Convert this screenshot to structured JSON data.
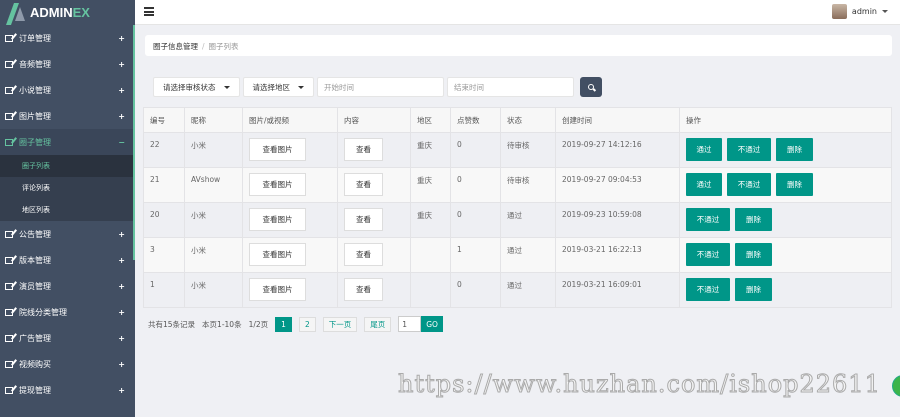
{
  "logo": {
    "main": "ADMIN",
    "accent": "EX"
  },
  "sidebar": {
    "items": [
      {
        "label": "订单管理",
        "toggle": "+"
      },
      {
        "label": "音频管理",
        "toggle": "+"
      },
      {
        "label": "小说管理",
        "toggle": "+"
      },
      {
        "label": "图片管理",
        "toggle": "+"
      },
      {
        "label": "圈子管理",
        "toggle": "−",
        "active": true,
        "children": [
          {
            "label": "圈子列表",
            "active": true
          },
          {
            "label": "评论列表"
          },
          {
            "label": "地区列表"
          }
        ]
      },
      {
        "label": "公告管理",
        "toggle": "+"
      },
      {
        "label": "版本管理",
        "toggle": "+"
      },
      {
        "label": "演员管理",
        "toggle": "+"
      },
      {
        "label": "院线分类管理",
        "toggle": "+"
      },
      {
        "label": "广告管理",
        "toggle": "+"
      },
      {
        "label": "视频购买",
        "toggle": "+"
      },
      {
        "label": "提现管理",
        "toggle": "+"
      }
    ]
  },
  "header": {
    "user": "admin"
  },
  "breadcrumb": {
    "parent": "圈子信息管理",
    "separator": "/",
    "current": "圈子列表"
  },
  "filters": {
    "status": "请选择审核状态",
    "region": "请选择地区",
    "start_placeholder": "开始时间",
    "end_placeholder": "结束时间"
  },
  "table": {
    "headers": [
      "编号",
      "昵称",
      "图片/或视频",
      "内容",
      "地区",
      "点赞数",
      "状态",
      "创建时间",
      "操作"
    ],
    "rows": [
      {
        "id": "22",
        "nick": "小米",
        "media": "查看图片",
        "content": "查看",
        "region": "重庆",
        "likes": "0",
        "status": "待审核",
        "created": "2019-09-27 14:12:16",
        "actions": [
          "通过",
          "不通过",
          "删除"
        ]
      },
      {
        "id": "21",
        "nick": "AVshow",
        "media": "查看图片",
        "content": "查看",
        "region": "重庆",
        "likes": "0",
        "status": "待审核",
        "created": "2019-09-27 09:04:53",
        "actions": [
          "通过",
          "不通过",
          "删除"
        ]
      },
      {
        "id": "20",
        "nick": "小米",
        "media": "查看图片",
        "content": "查看",
        "region": "重庆",
        "likes": "0",
        "status": "通过",
        "created": "2019-09-23 10:59:08",
        "actions": [
          "不通过",
          "删除"
        ]
      },
      {
        "id": "3",
        "nick": "小米",
        "media": "查看图片",
        "content": "查看",
        "region": "",
        "likes": "1",
        "status": "通过",
        "created": "2019-03-21 16:22:13",
        "actions": [
          "不通过",
          "删除"
        ]
      },
      {
        "id": "1",
        "nick": "小米",
        "media": "查看图片",
        "content": "查看",
        "region": "",
        "likes": "0",
        "status": "通过",
        "created": "2019-03-21 16:09:01",
        "actions": [
          "不通过",
          "删除"
        ]
      }
    ]
  },
  "pagination": {
    "total": "共有15条记录",
    "range": "本页1-10条",
    "pages": "1/2页",
    "page1": "1",
    "page2": "2",
    "next": "下一页",
    "last": "尾页",
    "jump_value": "1",
    "go": "GO"
  },
  "watermark": "https://www.huzhan.com/ishop22611"
}
